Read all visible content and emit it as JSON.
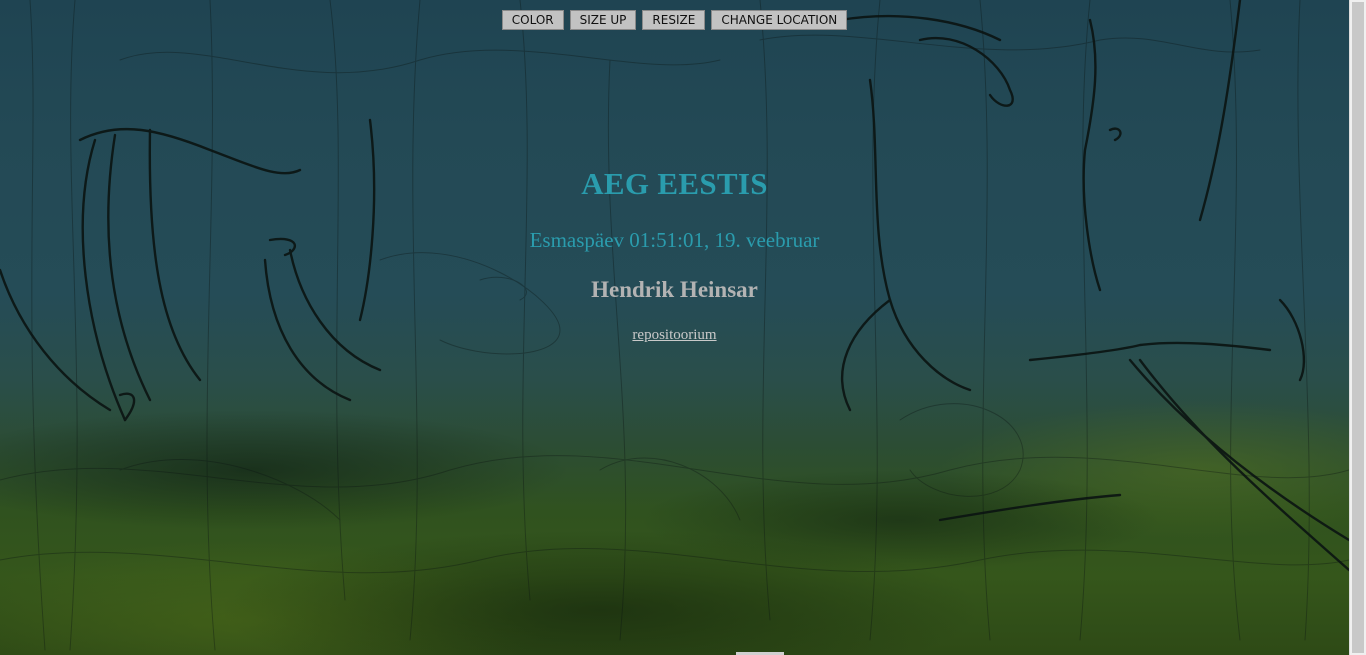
{
  "toolbar": {
    "buttons": [
      {
        "label": "COLOR"
      },
      {
        "label": "SIZE UP"
      },
      {
        "label": "RESIZE"
      },
      {
        "label": "CHANGE LOCATION"
      }
    ]
  },
  "clock": {
    "title": "AEG EESTIS",
    "datetime": "Esmaspäev 01:51:01, 19. veebruar",
    "author": "Hendrik Heinsar",
    "link_label": "repositoorium"
  },
  "colors": {
    "title": "#2a9cad",
    "author": "#b3b3b3",
    "button_bg": "#c2c2c2"
  },
  "icons": []
}
